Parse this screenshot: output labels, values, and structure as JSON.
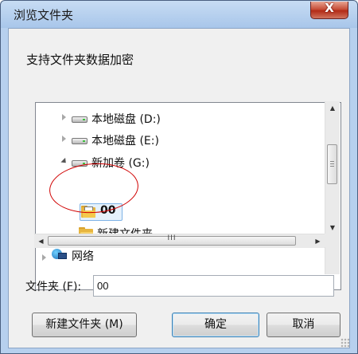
{
  "window": {
    "title": "浏览文件夹",
    "close_label": "X"
  },
  "description": "支持文件夹数据加密",
  "tree": {
    "items": [
      {
        "label": "本地磁盘 (D:)",
        "icon": "drive-icon",
        "expander": "collapsed"
      },
      {
        "label": "本地磁盘 (E:)",
        "icon": "drive-icon",
        "expander": "collapsed"
      },
      {
        "label": "新加卷 (G:)",
        "icon": "drive-icon",
        "expander": "expanded"
      },
      {
        "label": "00",
        "icon": "open-folder-icon",
        "selected": true
      },
      {
        "label": "新建文件夹",
        "icon": "folder-icon"
      },
      {
        "label": "网络",
        "icon": "network-icon",
        "expander": "collapsed"
      }
    ],
    "hscroll_grip": "III"
  },
  "folder_field": {
    "label": "文件夹 (F):",
    "value": "00"
  },
  "buttons": {
    "new_folder": "新建文件夹 (M)",
    "ok": "确定",
    "cancel": "取消"
  },
  "colors": {
    "selection": "#e5f1fb",
    "annotation": "#d00000",
    "close": "#c7503a"
  }
}
